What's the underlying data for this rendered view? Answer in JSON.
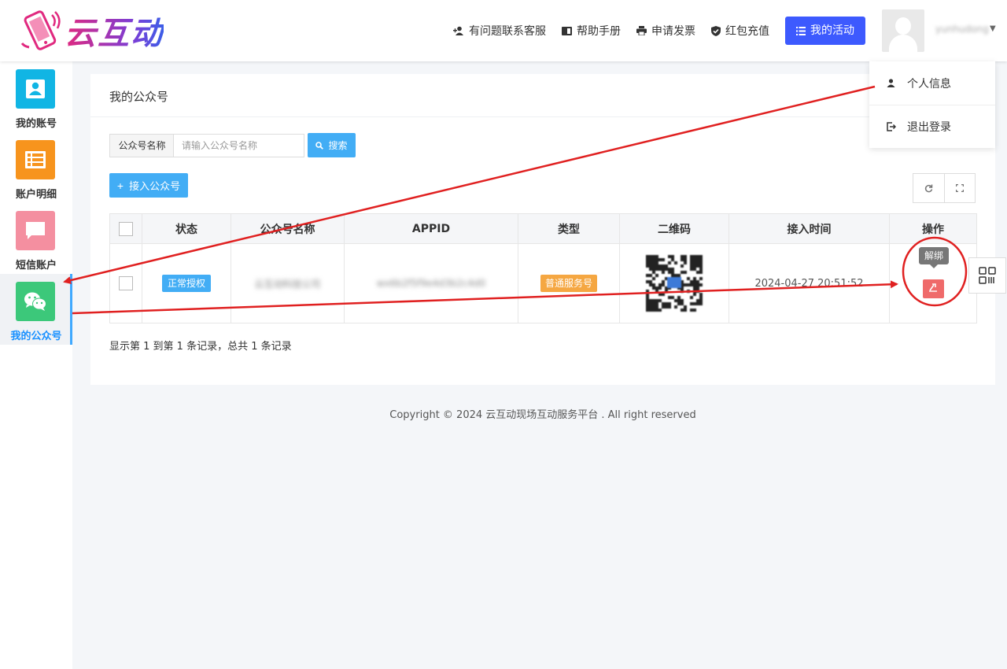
{
  "header": {
    "brand": "云互动",
    "nav": [
      {
        "label": "有问题联系客服",
        "icon": "user-plus-icon",
        "glyph": "👤"
      },
      {
        "label": "帮助手册",
        "icon": "book-icon",
        "glyph": "▮"
      },
      {
        "label": "申请发票",
        "icon": "printer-icon",
        "glyph": "⎙"
      },
      {
        "label": "红包充值",
        "icon": "shield-check-icon",
        "glyph": "✔"
      }
    ],
    "activity_button": "我的活动",
    "username": "yunhudong"
  },
  "user_menu": {
    "items": [
      {
        "label": "个人信息",
        "icon": "user-icon"
      },
      {
        "label": "退出登录",
        "icon": "logout-icon"
      }
    ]
  },
  "sidebar": {
    "items": [
      {
        "label": "我的账号",
        "icon": "id-card-icon",
        "color": "#11b5e4"
      },
      {
        "label": "账户明细",
        "icon": "list-icon",
        "color": "#f7941d"
      },
      {
        "label": "短信账户",
        "icon": "message-icon",
        "color": "#f48fa0"
      },
      {
        "label": "我的公众号",
        "icon": "wechat-icon",
        "color": "#3cc87a"
      }
    ]
  },
  "main": {
    "title": "我的公众号",
    "search": {
      "label": "公众号名称",
      "placeholder": "请输入公众号名称",
      "button": "搜索"
    },
    "add_button": "接入公众号",
    "table": {
      "headers": [
        "状态",
        "公众号名称",
        "APPID",
        "类型",
        "二维码",
        "接入时间",
        "操作"
      ],
      "rows": [
        {
          "status": "正常授权",
          "name": "云互动科技公司",
          "appid": "wx6b2f5f9e4d3b2c4d0",
          "type": "普通服务号",
          "time": "2024-04-27 20:51:52",
          "action_tooltip": "解绑"
        }
      ]
    },
    "summary": "显示第 1 到第 1 条记录，总共 1 条记录"
  },
  "footer": "Copyright © 2024 云互动现场互动服务平台 . All right reserved"
}
